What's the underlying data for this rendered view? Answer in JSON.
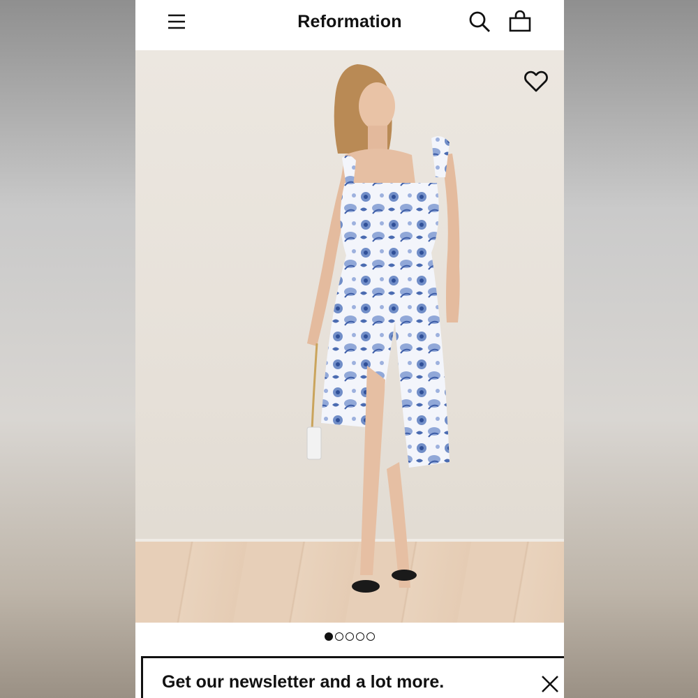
{
  "header": {
    "brand": "Reformation",
    "menu_icon": "hamburger-menu-icon",
    "search_icon": "search-icon",
    "bag_icon": "shopping-bag-icon"
  },
  "product_image": {
    "favorite_icon": "heart-outline-icon",
    "colors": {
      "dress_print": "#4f72b8",
      "dress_base": "#f3f5fb",
      "background": "#ece7e0",
      "floor": "#e5ccb4"
    }
  },
  "carousel": {
    "total": 5,
    "active_index": 0
  },
  "newsletter": {
    "text": "Get our newsletter and a lot more.",
    "close_icon": "close-icon"
  }
}
